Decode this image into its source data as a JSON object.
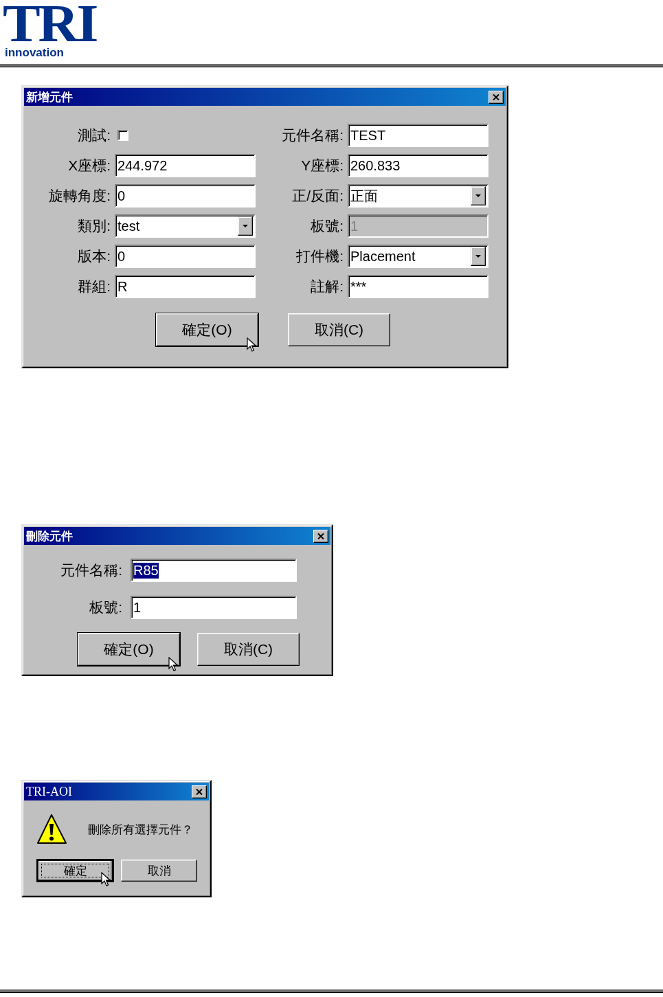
{
  "header": {
    "logo_letters": "TRI",
    "logo_text": "innovation"
  },
  "dialogs": [
    {
      "kind": "form2",
      "title": "新增元件",
      "rows": [
        {
          "left": {
            "label": "測試:",
            "kind": "checkbox",
            "checked": false
          },
          "right": {
            "label": "元件名稱:",
            "kind": "text",
            "value": "TEST"
          }
        },
        {
          "left": {
            "label": "X座標:",
            "kind": "text",
            "value": "244.972"
          },
          "right": {
            "label": "Y座標:",
            "kind": "text",
            "value": "260.833"
          }
        },
        {
          "left": {
            "label": "旋轉角度:",
            "kind": "text",
            "value": "0"
          },
          "right": {
            "label": "正/反面:",
            "kind": "dropdown",
            "value": "正面"
          }
        },
        {
          "left": {
            "label": "類別:",
            "kind": "dropdown",
            "value": "test"
          },
          "right": {
            "label": "板號:",
            "kind": "text",
            "value": "1",
            "disabled": true
          }
        },
        {
          "left": {
            "label": "版本:",
            "kind": "text",
            "value": "0"
          },
          "right": {
            "label": "打件機:",
            "kind": "dropdown",
            "value": "Placement"
          }
        },
        {
          "left": {
            "label": "群組:",
            "kind": "text",
            "value": "R"
          },
          "right": {
            "label": "註解:",
            "kind": "text",
            "value": "***"
          }
        }
      ],
      "buttons": [
        {
          "label": "確定(O)",
          "cursor": true,
          "focused": false
        },
        {
          "label": "取消(C)",
          "cursor": false,
          "focused": false
        }
      ]
    },
    {
      "kind": "form1",
      "title": "刪除元件",
      "rows": [
        {
          "label": "元件名稱:",
          "kind": "text",
          "value": "R85",
          "selected": true
        },
        {
          "label": "板號:",
          "kind": "text",
          "value": "1",
          "selected": false
        }
      ],
      "buttons": [
        {
          "label": "確定(O)",
          "cursor": true,
          "focused": false
        },
        {
          "label": "取消(C)",
          "cursor": false,
          "focused": false
        }
      ]
    },
    {
      "kind": "message",
      "title": "TRI-AOI",
      "message": "刪除所有選擇元件？",
      "buttons": [
        {
          "label": "確定",
          "cursor": true,
          "focused": true
        },
        {
          "label": "取消",
          "cursor": false,
          "focused": false
        }
      ]
    }
  ]
}
